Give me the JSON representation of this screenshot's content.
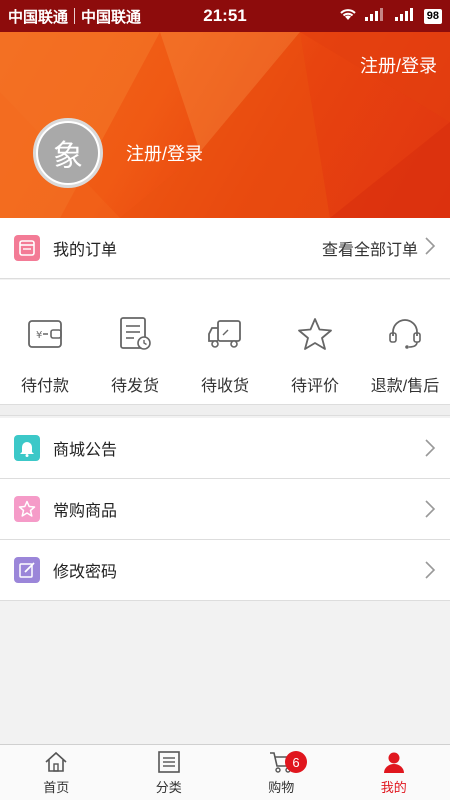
{
  "status_bar": {
    "carrier1": "中国联通",
    "carrier2": "中国联通",
    "time": "21:51",
    "battery": "98"
  },
  "header": {
    "top_login": "注册/登录",
    "avatar_char": "象",
    "profile_login": "注册/登录"
  },
  "orders": {
    "title": "我的订单",
    "view_all": "查看全部订单"
  },
  "order_status": [
    {
      "label": "待付款",
      "icon": "wallet-icon"
    },
    {
      "label": "待发货",
      "icon": "document-clock-icon"
    },
    {
      "label": "待收货",
      "icon": "truck-icon"
    },
    {
      "label": "待评价",
      "icon": "star-icon"
    },
    {
      "label": "退款/售后",
      "icon": "headset-icon"
    }
  ],
  "menu": [
    {
      "label": "商城公告",
      "icon": "bell-icon",
      "color": "#3cc8c8"
    },
    {
      "label": "常购商品",
      "icon": "star-icon",
      "color": "#f59bc8"
    },
    {
      "label": "修改密码",
      "icon": "edit-icon",
      "color": "#9b86d9"
    }
  ],
  "bottom_nav": {
    "home": "首页",
    "category": "分类",
    "cart": "购物",
    "cart_badge": "6",
    "mine": "我的"
  },
  "colors": {
    "accent": "#e0161e",
    "header_orange": "#f05a14",
    "order_icon": "#f37b96"
  }
}
